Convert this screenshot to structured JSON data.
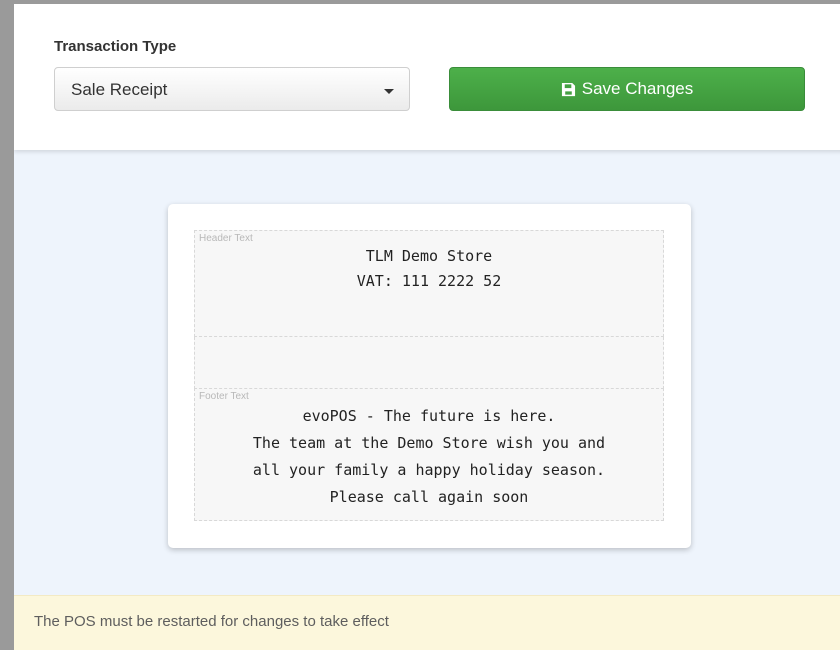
{
  "transaction": {
    "label": "Transaction Type",
    "selected": "Sale Receipt"
  },
  "toolbar": {
    "save_label": "Save Changes",
    "save_icon": "floppy-disk-icon"
  },
  "receipt": {
    "header_tag": "Header Text",
    "header_lines": [
      "TLM Demo Store",
      "VAT: 111 2222 52"
    ],
    "footer_tag": "Footer Text",
    "footer_lines": [
      "evoPOS - The future is here.",
      "The team at the Demo Store wish you and",
      "all your family a happy holiday season.",
      "Please call again soon"
    ]
  },
  "notice": {
    "text": "The POS must be restarted for changes to take effect"
  },
  "colors": {
    "save_button": "#449d44",
    "notice_background": "#fcf7dc",
    "page_background": "#eef4fc"
  }
}
